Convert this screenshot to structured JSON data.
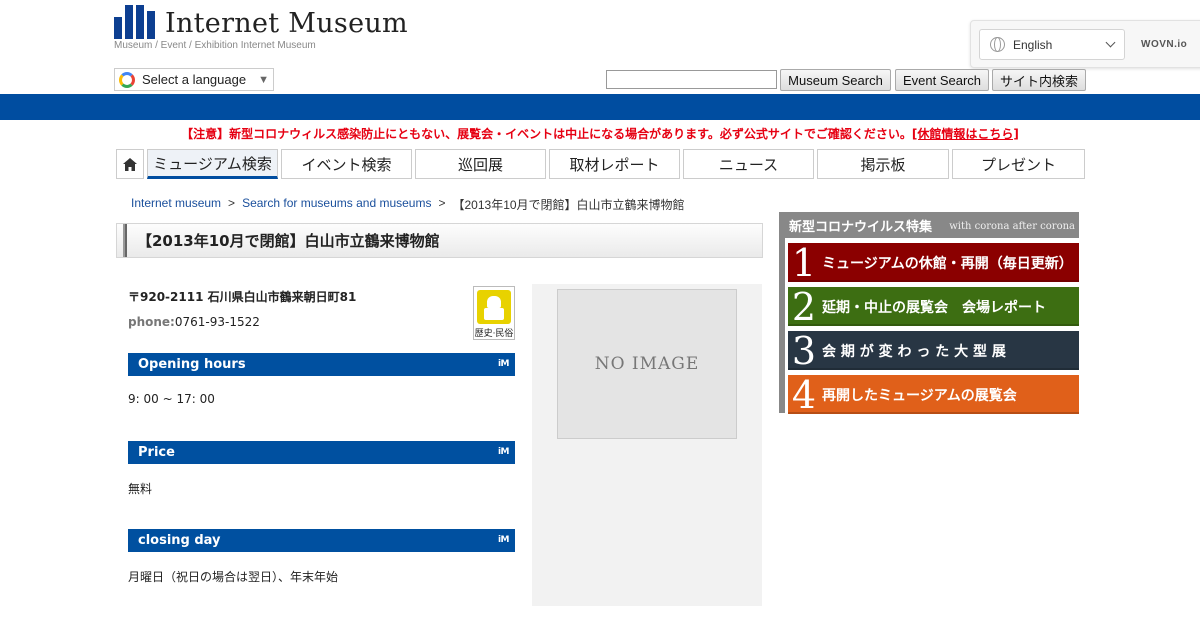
{
  "header": {
    "logo_text": "Internet Museum",
    "logo_sub": "Museum / Event / Exhibition Internet Museum",
    "language_widget": {
      "selected": "English",
      "brand": "WOVN.io"
    },
    "google_translate_label": "Select a language",
    "google_translate_arrow": "▼",
    "search_buttons": [
      "Museum Search",
      "Event Search",
      "サイト内検索"
    ]
  },
  "notice": {
    "text": "【注意】新型コロナウィルス感染防止にともない、展覧会・イベントは中止になる場合があります。必ず公式サイトでご確認ください。",
    "link_text": "[休館情報はこちら]"
  },
  "nav": {
    "items": [
      "ミュージアム検索",
      "イベント検索",
      "巡回展",
      "取材レポート",
      "ニュース",
      "掲示板",
      "プレゼント"
    ]
  },
  "breadcrumb": {
    "items": [
      "Internet museum",
      "Search for museums and museums",
      "【2013年10月で閉館】白山市立鶴来博物館"
    ],
    "separator": ">"
  },
  "page_title": "【2013年10月で閉館】白山市立鶴来博物館",
  "info": {
    "address": "〒920-2111 石川県白山市鶴来朝日町81",
    "phone_label": "phone:",
    "phone": "0761-93-1522",
    "category_label": "歴史·民俗",
    "sections": [
      {
        "heading": "Opening hours",
        "value": "9: 00 ~ 17: 00"
      },
      {
        "heading": "Price",
        "value": "無料"
      },
      {
        "heading": "closing day",
        "value": "月曜日（祝日の場合は翌日）、年末年始"
      }
    ],
    "heading_mark": "iM"
  },
  "image_placeholder": "NO IMAGE",
  "sidebar": {
    "title": "新型コロナウイルス特集",
    "subtitle": "with corona after corona",
    "banners": [
      {
        "num": "1",
        "text": "ミュージアムの休館・再開（毎日更新）",
        "color": "#8b0000"
      },
      {
        "num": "2",
        "text": "延期・中止の展覧会　会場レポート",
        "color": "#3d6e12"
      },
      {
        "num": "3",
        "text": "会 期 が 変 わ っ た 大 型 展",
        "color": "#283644"
      },
      {
        "num": "4",
        "text": "再開したミュージアムの展覧会",
        "color": "#e0601a"
      }
    ]
  }
}
